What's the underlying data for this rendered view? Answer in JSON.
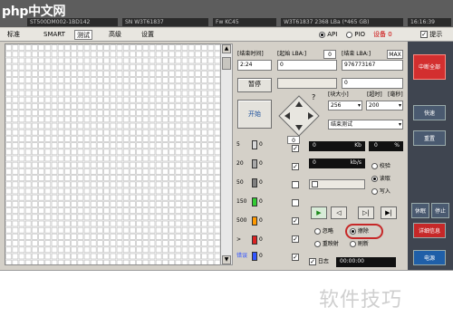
{
  "watermark_logo": "php中文网",
  "topbar": {
    "serial": "ST500DM002-1BD142",
    "sn": "SN  W3T61837",
    "fw": "Fw  KC45",
    "model_capacity": "W3T61837 2368 LBa (*465 GB)",
    "time": "16:16:39"
  },
  "menu": {
    "items": [
      "标准",
      "SMART",
      "测试",
      "高级",
      "设置"
    ],
    "active_index": 2,
    "api_label": "API",
    "pio_label": "PIO",
    "device_label": "设备 0",
    "hint_label": "提示"
  },
  "test": {
    "time_label": "[结束时间]",
    "time_value": "2:24",
    "start_lba_label": "[起始 LBA:]",
    "start_lba_value": "0",
    "start_lba_field": "0",
    "end_lba_label": "[结束 LBA:]",
    "max_label": "MAX",
    "end_lba_value": "976773167",
    "end_field": "0",
    "pause_label": "暂停",
    "start_label": "开始",
    "block_size_label": "[块大小]",
    "block_size": "256",
    "timeout_label": "[超时]",
    "timeout": "200",
    "speed_label": "[毫秒]",
    "end_test": "结束测试"
  },
  "legend": [
    {
      "label": "5",
      "count": "0",
      "color": "#d8d8d8"
    },
    {
      "label": "20",
      "count": "0",
      "color": "#a9a9a9"
    },
    {
      "label": "50",
      "count": "0",
      "color": "#808080"
    },
    {
      "label": "150",
      "count": "0",
      "color": "#33cc33"
    },
    {
      "label": "500",
      "count": "0",
      "color": "#ff9900"
    },
    {
      "label": ">",
      "count": "0",
      "color": "#dd2222"
    },
    {
      "label": "错误",
      "count": "0",
      "color": "#3355ff"
    }
  ],
  "meters": {
    "rw_counter": "0",
    "kb_label": "Kb",
    "percent_label": "%",
    "percent_value": "0",
    "speed_value": "0",
    "speed_unit": "kb/s",
    "verify": "校验",
    "read": "读取",
    "write": "写入",
    "ignore": "忽略",
    "erase": "擦除",
    "remap": "重映射",
    "refresh": "刷新",
    "selected_action": "erase",
    "selected_mode": "read",
    "log_label": "日志",
    "timer": "00:00:00"
  },
  "side": {
    "cancel_all": "中断全部",
    "quick_test": "快速",
    "reset": "重置",
    "sleep": "休眠",
    "stop": "停止",
    "detail": "详细信息",
    "power": "电源"
  },
  "footer": {
    "watermark_text": "软件技巧"
  }
}
